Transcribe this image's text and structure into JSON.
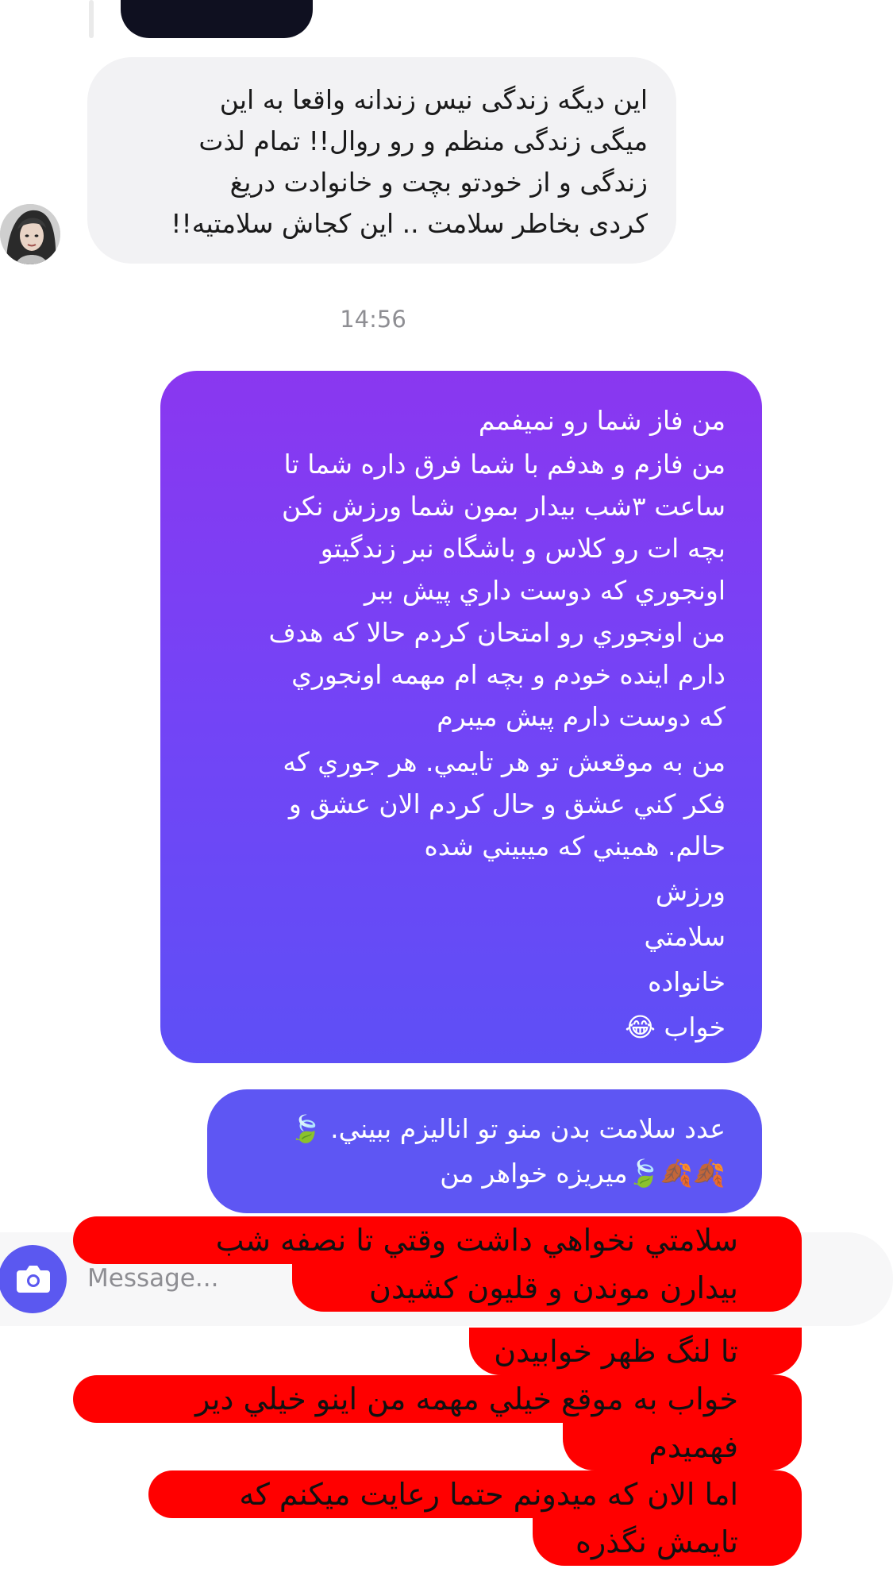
{
  "incoming": {
    "text": "این دیگه زندگی نیس زندانه واقعا به این\nمیگی زندگی منظم و رو روال!! تمام لذت\nزندگی و از خودتو بچت و خانوادت دریغ\nکردی بخاطر سلامت .. این کجاش سلامتیه!!"
  },
  "timestamp": "14:56",
  "outgoing1": {
    "p1": "من فاز شما رو نميفمم",
    "p2": "من فازم و هدفم با شما فرق داره شما تا\nساعت ٣شب بيدار بمون  شما ورزش نكن\nبچه ات رو كلاس و باشگاه نبر  زندگيتو\nاونجوري كه دوست داري پيش ببر\nمن اونجوري  رو امتحان كردم  حالا كه هدف\nدارم  اينده خودم و بچه ام مهمه اونجوري\nكه دوست دارم پيش ميبرم",
    "p3": "من به موقعش تو هر تايمي. هر جوري كه\nفكر كني عشق و حال كردم  الان عشق و\nحالم. هميني كه ميبيني شده",
    "item1": "ورزش",
    "item2": "سلامتي",
    "item3": "خانواده",
    "item4": "خواب 😂"
  },
  "outgoing2": {
    "text": "عدد سلامت بدن منو تو اناليزم ببيني. 🍃\n🍂🍂🍃ميريزه خواهر من"
  },
  "composer": {
    "placeholder": "Message..."
  },
  "overlay": {
    "l1": "سلامتي  نخواهي داشت  وقتي تا نصفه شب",
    "l2": "بيدارن موندن و قليون كشيدن",
    "l3": "تا لنگ ظهر خوابيدن",
    "l4": "خواب  به موقع  خيلي مهمه من اينو خيلي دير",
    "l5": "فهميدم",
    "l6": "اما الان كه ميدونم حتما رعايت ميكنم كه",
    "l7": "تايمش نگذره"
  },
  "colors": {
    "incoming_bubble": "#f2f2f4",
    "outgoing_gradient_top": "#8a37f0",
    "outgoing_gradient_bottom": "#5e4ff6",
    "outgoing_bubble_2": "#5e56f3",
    "camera_button": "#5b58f0",
    "overlay_red": "#ff0000"
  }
}
